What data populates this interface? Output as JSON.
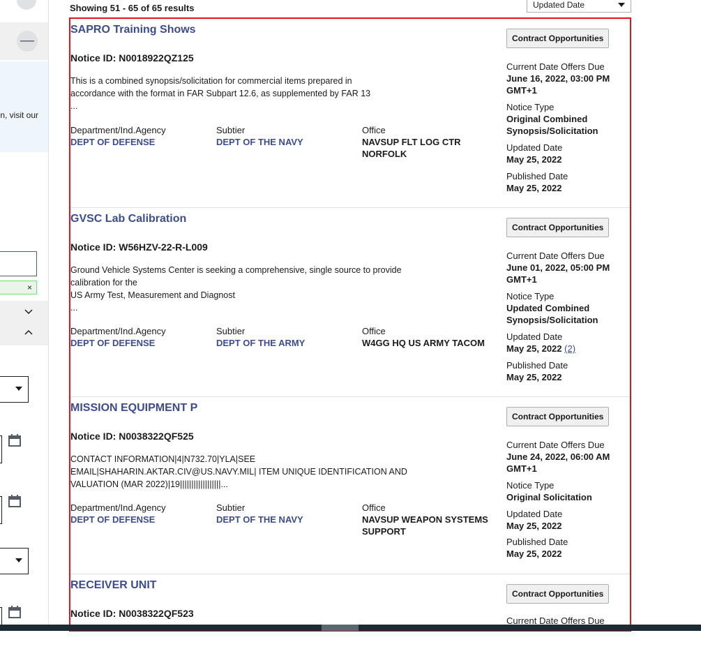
{
  "results_header": {
    "count_text": "Showing 51 - 65 of 65 results",
    "sort_label": "Updated Date"
  },
  "sidebar": {
    "collapse_symbol": "—",
    "info_text_fragment": "n, visit our",
    "chip_close": "×"
  },
  "labels": {
    "notice_prefix": "Notice ID: ",
    "department": "Department/Ind.Agency",
    "subtier": "Subtier",
    "office": "Office",
    "offers_due": "Current Date Offers Due",
    "notice_type": "Notice Type",
    "updated_date": "Updated Date",
    "published_date": "Published Date"
  },
  "results": [
    {
      "title": "SAPRO Training Shows",
      "notice_id": "N0018922QZ125",
      "description": [
        "This is a combined synopsis/solicitation for commercial items prepared in",
        "accordance with the format in FAR Subpart 12.6, as supplemented by FAR 13",
        "..."
      ],
      "department": "DEPT OF DEFENSE",
      "subtier": "DEPT OF THE NAVY",
      "office": [
        "NAVSUP FLT LOG CTR",
        "NORFOLK"
      ],
      "tag": "Contract Opportunities",
      "offers_due": [
        "June 16, 2022, 03:00 PM",
        "GMT+1"
      ],
      "notice_type": [
        "Original Combined",
        "Synopsis/Solicitation"
      ],
      "updated_date": "May 25, 2022",
      "updated_count": "",
      "published_date": "May 25, 2022"
    },
    {
      "title": "GVSC Lab Calibration",
      "notice_id": "W56HZV-22-R-L009",
      "description": [
        "Ground Vehicle Systems Center is seeking a comprehensive, single source to provide",
        "calibration for the",
        "US Army Test, Measurement and Diagnost",
        "..."
      ],
      "department": "DEPT OF DEFENSE",
      "subtier": "DEPT OF THE ARMY",
      "office": [
        "W4GG HQ US ARMY TACOM"
      ],
      "tag": "Contract Opportunities",
      "offers_due": [
        "June 01, 2022, 05:00 PM",
        "GMT+1"
      ],
      "notice_type": [
        "Updated Combined",
        "Synopsis/Solicitation"
      ],
      "updated_date": "May 25, 2022",
      "updated_count": "(2)",
      "published_date": "May 25, 2022"
    },
    {
      "title": "MISSION EQUIPMENT P",
      "notice_id": "N0038322QF525",
      "description": [
        "CONTACT INFORMATION|4|N732.70|YLA|SEE",
        "EMAIL|SHAHARIN.AKTAR.CIV@US.NAVY.MIL| ITEM UNIQUE IDENTIFICATION AND",
        "VALUATION (MAR 2022)|19||||||||||||||||||..."
      ],
      "department": "DEPT OF DEFENSE",
      "subtier": "DEPT OF THE NAVY",
      "office": [
        "NAVSUP WEAPON SYSTEMS",
        "SUPPORT"
      ],
      "tag": "Contract Opportunities",
      "offers_due": [
        "June 24, 2022, 06:00 AM",
        "GMT+1"
      ],
      "notice_type": [
        "Original Solicitation"
      ],
      "updated_date": "May 25, 2022",
      "updated_count": "",
      "published_date": "May 25, 2022"
    },
    {
      "title": "RECEIVER UNIT",
      "notice_id": "N0038322QF523",
      "tag": "Contract Opportunities"
    }
  ]
}
